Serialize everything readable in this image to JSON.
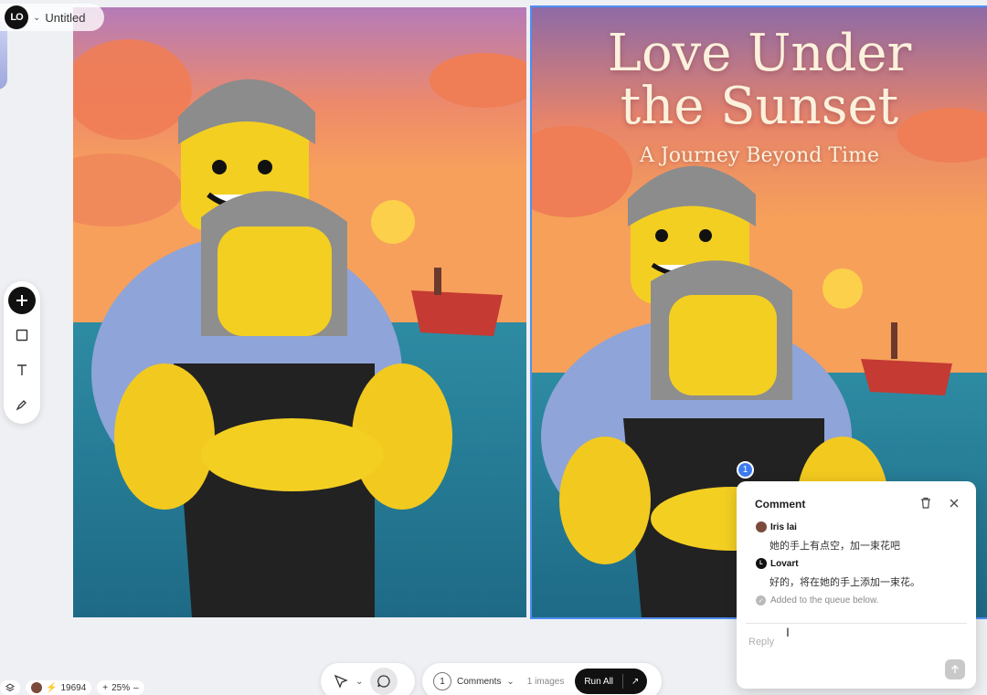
{
  "header": {
    "title": "Untitled",
    "logo_text": "LO"
  },
  "poster": {
    "title_line1": "Love Under",
    "title_line2": "the Sunset",
    "subtitle": "A Journey Beyond Time"
  },
  "toolbar": {
    "items": [
      "add",
      "rectangle",
      "text",
      "pen"
    ]
  },
  "comment": {
    "marker_number": "1",
    "heading": "Comment",
    "messages": [
      {
        "author": "Iris lai",
        "text": "她的手上有点空，加一束花吧"
      },
      {
        "author": "Lovart",
        "text": "好的，将在她的手上添加一束花。"
      }
    ],
    "status": "Added to the queue below.",
    "reply_placeholder": "Reply"
  },
  "bottom": {
    "credits": "19694",
    "zoom": "25%",
    "comment_count": "1",
    "comments_label": "Comments",
    "images_label": "1 images",
    "run_all_label": "Run All"
  },
  "colors": {
    "accent": "#3d7cf0",
    "selection": "#4d8ef5"
  }
}
